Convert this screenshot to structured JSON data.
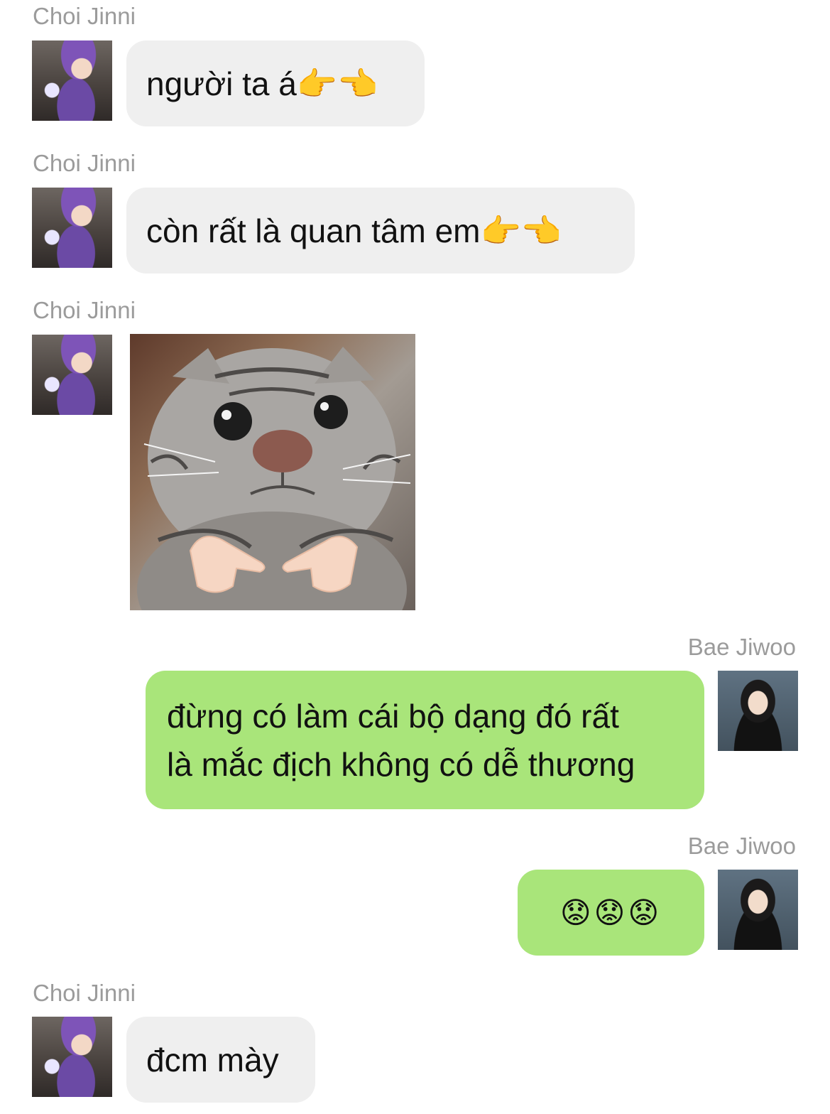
{
  "messages": [
    {
      "sender": "Choi Jinni",
      "side": "left",
      "text": "người ta á👉👈"
    },
    {
      "sender": "Choi Jinni",
      "side": "left",
      "text": "còn rất là quan tâm em👉👈"
    },
    {
      "sender": "Choi Jinni",
      "side": "left",
      "image": "cat pointing fingers photo"
    },
    {
      "sender": "Bae Jiwoo",
      "side": "right",
      "lines": [
        "đừng có làm cái bộ dạng đó rất",
        "là mắc địch không có dễ thương"
      ]
    },
    {
      "sender": "Bae Jiwoo",
      "side": "right",
      "text": "😟😟😟"
    },
    {
      "sender": "Choi Jinni",
      "side": "left",
      "text": "đcm mày"
    }
  ],
  "colors": {
    "incoming_bubble": "#efefef",
    "outgoing_bubble": "#a9e57a",
    "sender_name": "#9b9b9b"
  }
}
